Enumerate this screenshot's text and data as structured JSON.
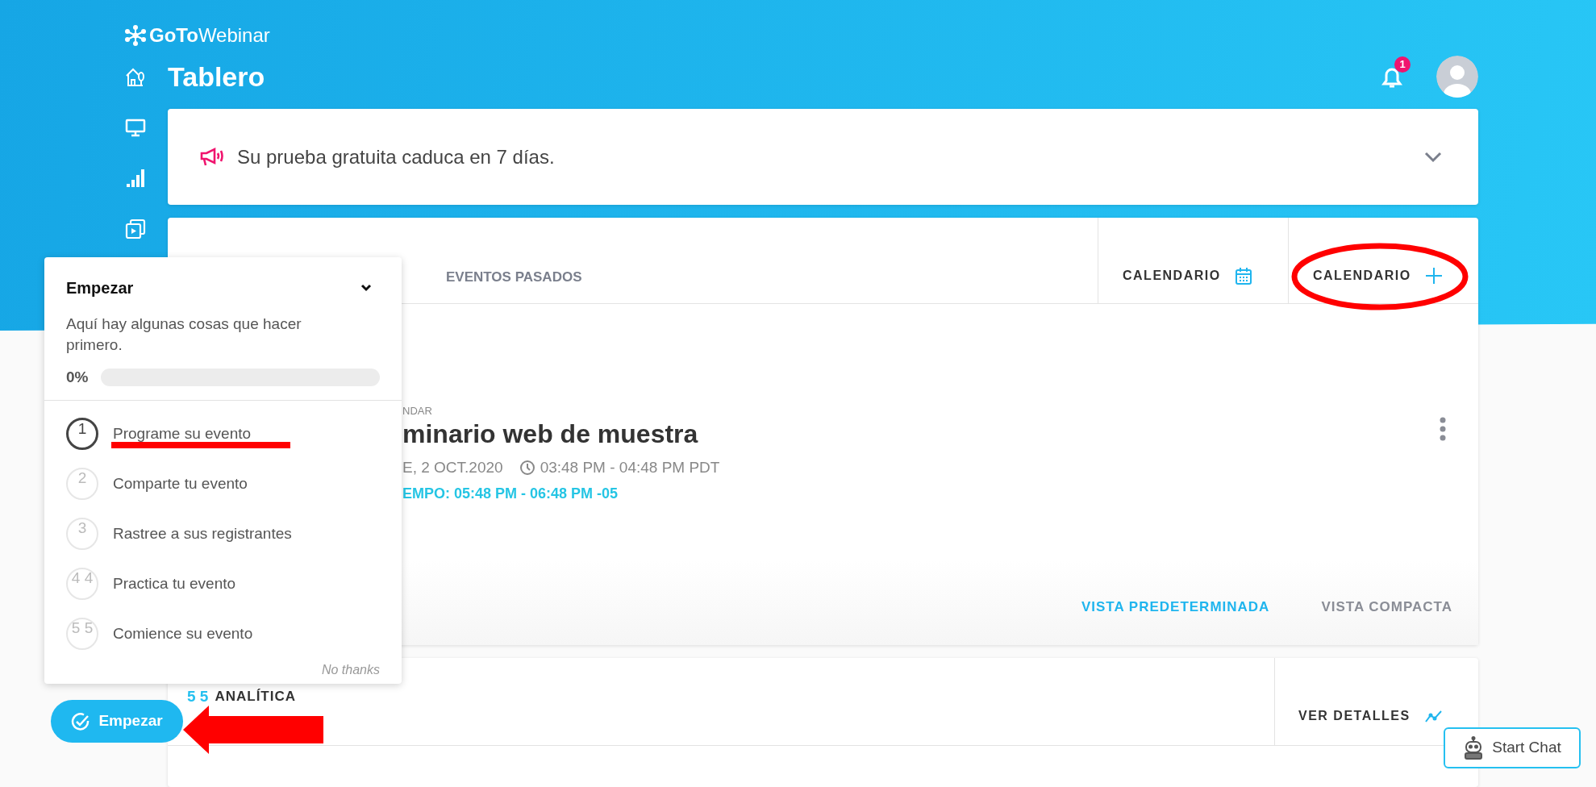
{
  "logo": {
    "text": "**GoTo**Webinar"
  },
  "page_title": "Tablero",
  "notifications": {
    "count": "1"
  },
  "banner": {
    "message": "Su prueba gratuita caduca en 7 días.",
    "expanded": false
  },
  "events_panel": {
    "tabs": [
      {
        "label": "EVENTOS PASADOS",
        "selected": false
      }
    ],
    "actions": [
      {
        "label": "CALENDARIO",
        "kind": "calendar"
      },
      {
        "label": "CALENDARIO",
        "kind": "add"
      }
    ],
    "event": {
      "label": "NDAR",
      "title": "minario web de muestra",
      "date": "E, 2 OCT.2020",
      "time": "03:48 PM - 04:48 PM PDT",
      "local_time": "EMPO: 05:48 PM - 06:48 PM -05"
    },
    "views": [
      {
        "label": "VISTA PREDETERMINADA",
        "selected": true
      },
      {
        "label": "VISTA COMPACTA",
        "selected": false
      }
    ]
  },
  "analytics": {
    "overlap_text": "5 5",
    "title": "ANALÍTICA",
    "action": "VER DETALLES"
  },
  "getting_started": {
    "title": "Empezar",
    "description": "Aquí hay algunas cosas que hacer primero.",
    "progress_label": "0%",
    "level": 0,
    "steps": [
      {
        "number": "1",
        "label": "Programe su evento",
        "selected": true
      },
      {
        "number": "2",
        "label": "Comparte tu evento",
        "selected": false
      },
      {
        "number": "3",
        "label": "Rastree a sus registrantes",
        "selected": false
      },
      {
        "number": "4 4",
        "label": "Practica tu evento",
        "selected": false
      },
      {
        "number": "5 5",
        "label": "Comience su evento",
        "selected": false
      }
    ],
    "dismiss": "No thanks"
  },
  "launcher": {
    "label": "Empezar"
  },
  "chat": {
    "label": "Start Chat"
  }
}
